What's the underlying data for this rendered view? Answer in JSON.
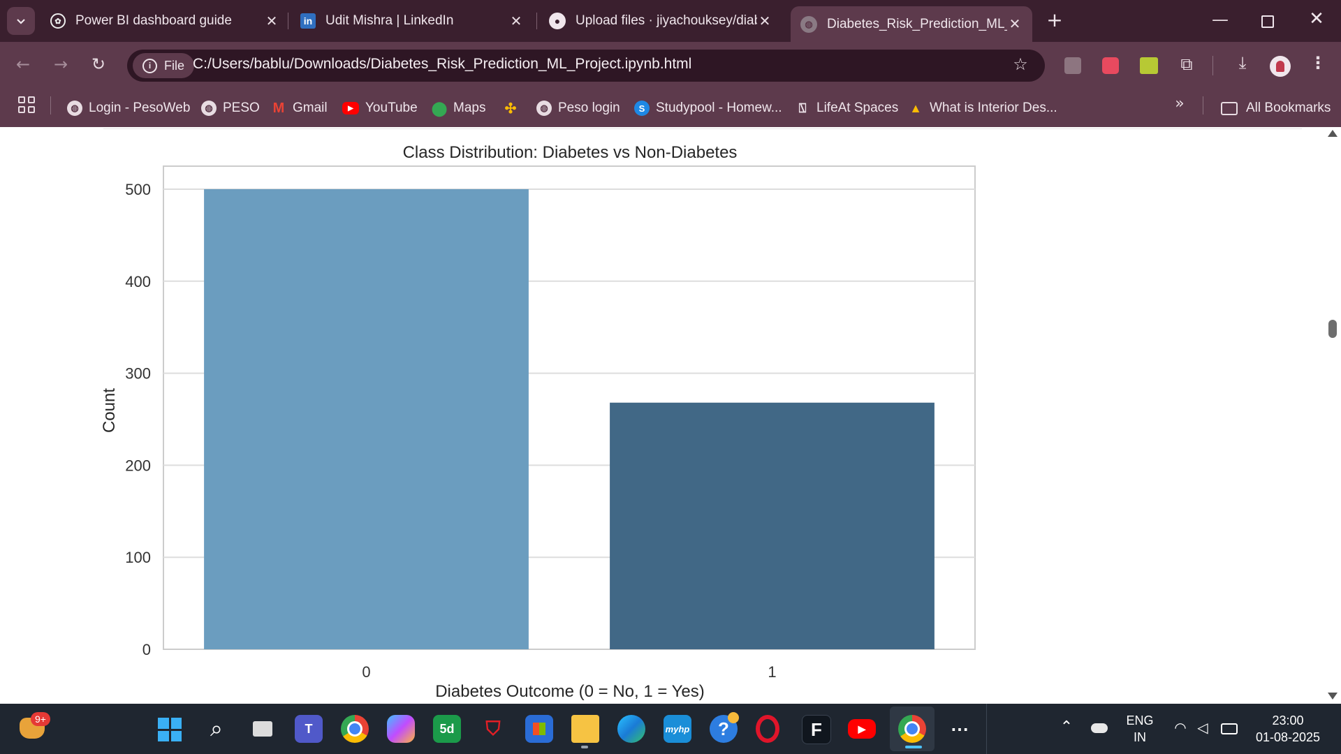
{
  "tabs": [
    {
      "title": "Power BI dashboard guide",
      "icon": "chatgpt-icon"
    },
    {
      "title": "Udit Mishra | LinkedIn",
      "icon": "linkedin-icon"
    },
    {
      "title": "Upload files · jiyachouksey/diab",
      "icon": "github-icon"
    },
    {
      "title": "Diabetes_Risk_Prediction_ML_Pr",
      "icon": "globe-icon",
      "active": true
    }
  ],
  "omnibox": {
    "scheme_label": "File",
    "url": "C:/Users/bablu/Downloads/Diabetes_Risk_Prediction_ML_Project.ipynb.html"
  },
  "bookmarks": [
    {
      "label": "Login - PesoWeb",
      "icon": "globe-icon"
    },
    {
      "label": "PESO",
      "icon": "globe-icon"
    },
    {
      "label": "Gmail",
      "icon": "gmail-icon"
    },
    {
      "label": "YouTube",
      "icon": "youtube-icon"
    },
    {
      "label": "Maps",
      "icon": "maps-icon"
    },
    {
      "label": "",
      "icon": "pinwheel-icon"
    },
    {
      "label": "Peso login",
      "icon": "globe-icon"
    },
    {
      "label": "Studypool - Homew...",
      "icon": "studypool-icon"
    },
    {
      "label": "LifeAt Spaces",
      "icon": "lifeat-icon"
    },
    {
      "label": "What is Interior Des...",
      "icon": "drive-icon"
    }
  ],
  "all_bookmarks_label": "All Bookmarks",
  "chart_data": {
    "type": "bar",
    "title": "Class Distribution: Diabetes vs Non-Diabetes",
    "xlabel": "Diabetes Outcome (0 = No, 1 = Yes)",
    "ylabel": "Count",
    "categories": [
      "0",
      "1"
    ],
    "values": [
      500,
      268
    ],
    "ylim": [
      0,
      525
    ],
    "yticks": [
      0,
      100,
      200,
      300,
      400,
      500
    ],
    "grid": true,
    "colors": [
      "#6b9dbf",
      "#416886"
    ]
  },
  "taskbar": {
    "notification_badge": "9+",
    "language_top": "ENG",
    "language_bottom": "IN",
    "time": "23:00",
    "date": "01-08-2025"
  }
}
